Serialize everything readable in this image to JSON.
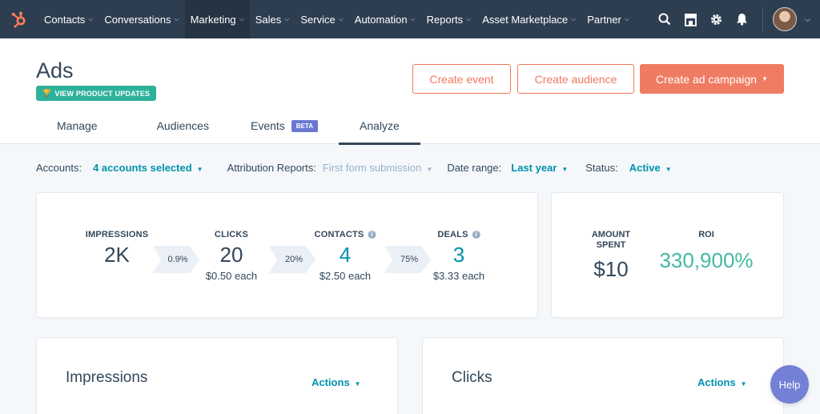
{
  "nav": {
    "items": [
      {
        "label": "Contacts"
      },
      {
        "label": "Conversations"
      },
      {
        "label": "Marketing",
        "active": true
      },
      {
        "label": "Sales"
      },
      {
        "label": "Service"
      },
      {
        "label": "Automation"
      },
      {
        "label": "Reports"
      },
      {
        "label": "Asset Marketplace"
      },
      {
        "label": "Partner"
      }
    ],
    "brand_color": "#ff7a59"
  },
  "header": {
    "title": "Ads",
    "product_updates_label": "VIEW PRODUCT UPDATES",
    "buttons": {
      "create_event": "Create event",
      "create_audience": "Create audience",
      "create_campaign": "Create ad campaign"
    },
    "tabs": [
      {
        "label": "Manage"
      },
      {
        "label": "Audiences"
      },
      {
        "label": "Events",
        "badge": "BETA"
      },
      {
        "label": "Analyze",
        "active": true
      }
    ]
  },
  "filters": {
    "accounts_label": "Accounts:",
    "accounts_value": "4 accounts selected",
    "attribution_label": "Attribution Reports:",
    "attribution_value": "First form submission",
    "date_label": "Date range:",
    "date_value": "Last year",
    "status_label": "Status:",
    "status_value": "Active"
  },
  "funnel": {
    "impressions": {
      "label": "IMPRESSIONS",
      "value": "2K"
    },
    "rate1": "0.9%",
    "clicks": {
      "label": "CLICKS",
      "value": "20",
      "sub": "$0.50 each"
    },
    "rate2": "20%",
    "contacts": {
      "label": "CONTACTS",
      "value": "4",
      "sub": "$2.50 each"
    },
    "rate3": "75%",
    "deals": {
      "label": "DEALS",
      "value": "3",
      "sub": "$3.33 each"
    }
  },
  "summary": {
    "amount_spent_label_1": "AMOUNT",
    "amount_spent_label_2": "SPENT",
    "amount_spent_value": "$10",
    "roi_label": "ROI",
    "roi_value": "330,900%"
  },
  "cards": {
    "impressions_title": "Impressions",
    "clicks_title": "Clicks",
    "actions_label": "Actions"
  },
  "help_label": "Help",
  "colors": {
    "nav_bg": "#2d3e50",
    "accent": "#ef7b62",
    "link": "#0091ae",
    "roi_green": "#45b8a1",
    "beta": "#6a78d1",
    "help": "#7480d6"
  }
}
